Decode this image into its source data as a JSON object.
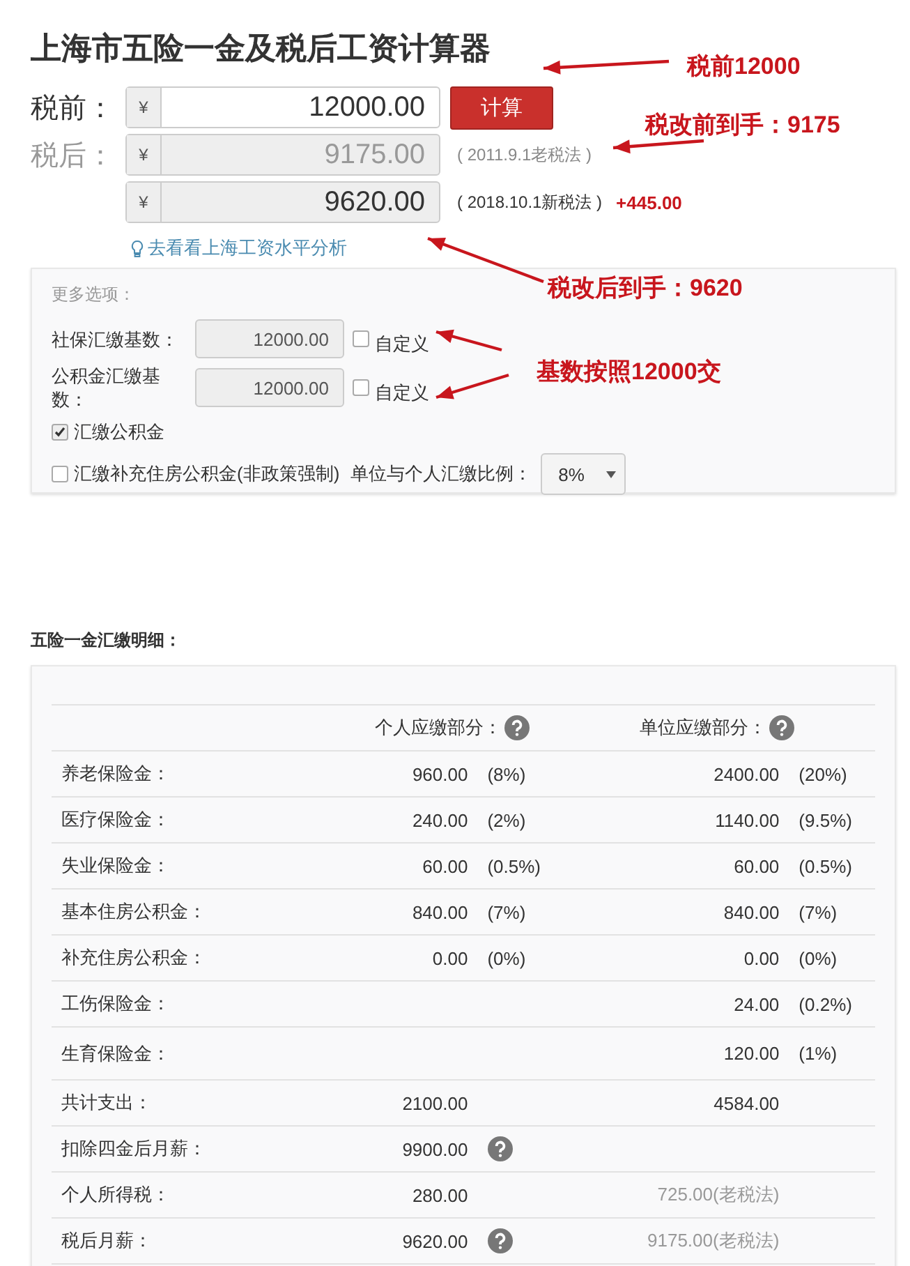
{
  "title": "上海市五险一金及税后工资计算器",
  "calc": {
    "pre_label": "税前：",
    "currency": "¥",
    "pre_value": "12000.00",
    "button": "计算",
    "post_label": "税后：",
    "results": [
      {
        "value": "9175.00",
        "note": "( 2011.9.1老税法 )",
        "dimmed": true
      },
      {
        "value": "9620.00",
        "note": "( 2018.10.1新税法 )",
        "diff": "+445.00",
        "dimmed": false
      }
    ],
    "link": "去看看上海工资水平分析"
  },
  "options": {
    "title": "更多选项：",
    "bases": [
      {
        "label": "社保汇缴基数：",
        "value": "12000.00",
        "custom_label": "自定义",
        "checked": false
      },
      {
        "label": "公积金汇缴基数：",
        "value": "12000.00",
        "custom_label": "自定义",
        "checked": false
      }
    ],
    "fund": {
      "label": "汇缴公积金",
      "checked": true
    },
    "supplement": {
      "label": "汇缴补充住房公积金(非政策强制)",
      "checked": false
    },
    "ratio_label": "单位与个人汇缴比例：",
    "ratio_value": "8%"
  },
  "detail": {
    "title": "五险一金汇缴明细：",
    "personal_header": "个人应缴部分：",
    "company_header": "单位应缴部分：",
    "rows": [
      {
        "label": "养老保险金：",
        "personal": "960.00",
        "personal_pct": "(8%)",
        "company": "2400.00",
        "company_pct": "(20%)"
      },
      {
        "label": "医疗保险金：",
        "personal": "240.00",
        "personal_pct": "(2%)",
        "company": "1140.00",
        "company_pct": "(9.5%)"
      },
      {
        "label": "失业保险金：",
        "personal": "60.00",
        "personal_pct": "(0.5%)",
        "company": "60.00",
        "company_pct": "(0.5%)"
      },
      {
        "label": "基本住房公积金：",
        "personal": "840.00",
        "personal_pct": "(7%)",
        "company": "840.00",
        "company_pct": "(7%)"
      },
      {
        "label": "补充住房公积金：",
        "personal": "0.00",
        "personal_pct": "(0%)",
        "company": "0.00",
        "company_pct": "(0%)"
      },
      {
        "label": "工伤保险金：",
        "company": "24.00",
        "company_pct": "(0.2%)"
      },
      {
        "label": "生育保险金：",
        "company": "120.00",
        "company_pct": "(1%)"
      },
      {
        "label": "共计支出：",
        "personal": "2100.00",
        "company": "4584.00"
      },
      {
        "label": "扣除四金后月薪：",
        "personal": "9900.00",
        "help": true
      },
      {
        "label": "个人所得税：",
        "personal": "280.00",
        "company": "725.00(老税法)",
        "company_dimmed": true
      },
      {
        "label": "税后月薪：",
        "personal": "9620.00",
        "company": "9175.00(老税法)",
        "help": true,
        "company_dimmed": true
      }
    ]
  },
  "annotations": [
    {
      "text": "税前12000"
    },
    {
      "text": "税改前到手：9175"
    },
    {
      "text": "税改后到手：9620"
    },
    {
      "text": "基数按照12000交"
    }
  ]
}
